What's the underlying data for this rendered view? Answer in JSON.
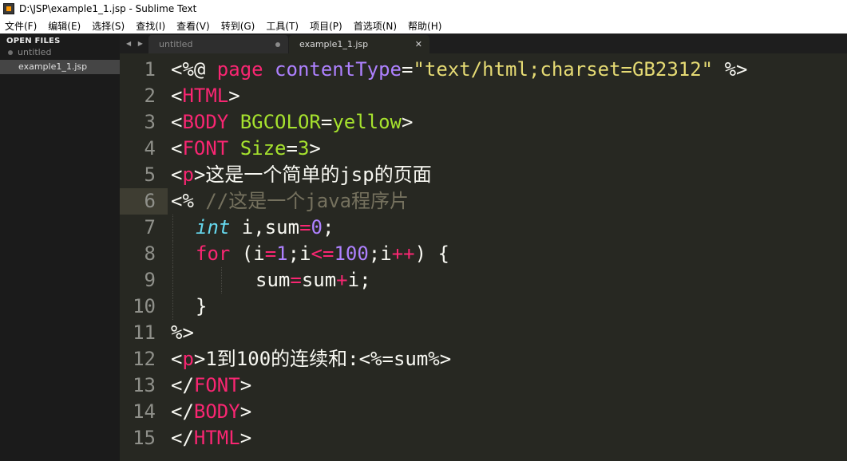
{
  "window": {
    "title": "D:\\JSP\\example1_1.jsp - Sublime Text"
  },
  "menu": [
    "文件(F)",
    "编辑(E)",
    "选择(S)",
    "查找(I)",
    "查看(V)",
    "转到(G)",
    "工具(T)",
    "项目(P)",
    "首选项(N)",
    "帮助(H)"
  ],
  "sidebar": {
    "header": "OPEN FILES",
    "files": [
      {
        "name": "untitled",
        "active": false,
        "modified": true
      },
      {
        "name": "example1_1.jsp",
        "active": true,
        "modified": false
      }
    ]
  },
  "tabs": [
    {
      "label": "untitled",
      "active": false,
      "modified": true
    },
    {
      "label": "example1_1.jsp",
      "active": true,
      "modified": false
    }
  ],
  "tab_arrows": "◀ ▶",
  "tab_close_glyph": "✕",
  "editor": {
    "current_line": 6,
    "theme_colors": {
      "background": "#272822",
      "keyword": "#f92672",
      "attribute": "#a6e22e",
      "string": "#e6db74",
      "number": "#ae81ff",
      "type": "#66d9ef",
      "comment": "#75715e"
    },
    "lines": [
      {
        "num": "1",
        "indent": 0,
        "tokens": [
          {
            "t": "<%@ ",
            "c": "white"
          },
          {
            "t": "page",
            "c": "pink"
          },
          {
            "t": " ",
            "c": "white"
          },
          {
            "t": "contentType",
            "c": "purple2"
          },
          {
            "t": "=",
            "c": "white"
          },
          {
            "t": "\"text/html;charset=GB2312\"",
            "c": "yellow"
          },
          {
            "t": " %>",
            "c": "white"
          }
        ]
      },
      {
        "num": "2",
        "indent": 0,
        "tokens": [
          {
            "t": "<",
            "c": "white"
          },
          {
            "t": "HTML",
            "c": "pink"
          },
          {
            "t": ">",
            "c": "white"
          }
        ]
      },
      {
        "num": "3",
        "indent": 0,
        "tokens": [
          {
            "t": "<",
            "c": "white"
          },
          {
            "t": "BODY",
            "c": "pink"
          },
          {
            "t": " ",
            "c": "white"
          },
          {
            "t": "BGCOLOR",
            "c": "green"
          },
          {
            "t": "=",
            "c": "white"
          },
          {
            "t": "yellow",
            "c": "green"
          },
          {
            "t": ">",
            "c": "white"
          }
        ]
      },
      {
        "num": "4",
        "indent": 0,
        "tokens": [
          {
            "t": "<",
            "c": "white"
          },
          {
            "t": "FONT",
            "c": "pink"
          },
          {
            "t": " ",
            "c": "white"
          },
          {
            "t": "Size",
            "c": "green"
          },
          {
            "t": "=",
            "c": "white"
          },
          {
            "t": "3",
            "c": "green"
          },
          {
            "t": ">",
            "c": "white"
          }
        ]
      },
      {
        "num": "5",
        "indent": 0,
        "tokens": [
          {
            "t": "<",
            "c": "white"
          },
          {
            "t": "p",
            "c": "pink"
          },
          {
            "t": ">这是一个简单的jsp的页面",
            "c": "white"
          }
        ]
      },
      {
        "num": "6",
        "indent": 0,
        "tokens": [
          {
            "t": "<% ",
            "c": "white"
          },
          {
            "t": "//这是一个java程序片",
            "c": "comment"
          }
        ]
      },
      {
        "num": "7",
        "indent": 1,
        "tokens": [
          {
            "t": "int",
            "c": "cyan-it"
          },
          {
            "t": " i,sum",
            "c": "white"
          },
          {
            "t": "=",
            "c": "pink"
          },
          {
            "t": "0",
            "c": "purple"
          },
          {
            "t": ";",
            "c": "white"
          }
        ]
      },
      {
        "num": "8",
        "indent": 1,
        "tokens": [
          {
            "t": "for",
            "c": "pink"
          },
          {
            "t": " (i",
            "c": "white"
          },
          {
            "t": "=",
            "c": "pink"
          },
          {
            "t": "1",
            "c": "purple"
          },
          {
            "t": ";i",
            "c": "white"
          },
          {
            "t": "<=",
            "c": "pink"
          },
          {
            "t": "100",
            "c": "purple"
          },
          {
            "t": ";i",
            "c": "white"
          },
          {
            "t": "++",
            "c": "pink"
          },
          {
            "t": ") {",
            "c": "white"
          }
        ]
      },
      {
        "num": "9",
        "indent": 2,
        "tokens": [
          {
            "t": "sum",
            "c": "white"
          },
          {
            "t": "=",
            "c": "pink"
          },
          {
            "t": "sum",
            "c": "white"
          },
          {
            "t": "+",
            "c": "pink"
          },
          {
            "t": "i;",
            "c": "white"
          }
        ]
      },
      {
        "num": "10",
        "indent": 1,
        "tokens": [
          {
            "t": "}",
            "c": "white"
          }
        ]
      },
      {
        "num": "11",
        "indent": 0,
        "tokens": [
          {
            "t": "%>",
            "c": "white"
          }
        ]
      },
      {
        "num": "12",
        "indent": 0,
        "tokens": [
          {
            "t": "<",
            "c": "white"
          },
          {
            "t": "p",
            "c": "pink"
          },
          {
            "t": ">1到100的连续和:<%=sum%>",
            "c": "white"
          }
        ]
      },
      {
        "num": "13",
        "indent": 0,
        "tokens": [
          {
            "t": "</",
            "c": "white"
          },
          {
            "t": "FONT",
            "c": "pink"
          },
          {
            "t": ">",
            "c": "white"
          }
        ]
      },
      {
        "num": "14",
        "indent": 0,
        "tokens": [
          {
            "t": "</",
            "c": "white"
          },
          {
            "t": "BODY",
            "c": "pink"
          },
          {
            "t": ">",
            "c": "white"
          }
        ]
      },
      {
        "num": "15",
        "indent": 0,
        "tokens": [
          {
            "t": "</",
            "c": "white"
          },
          {
            "t": "HTML",
            "c": "pink"
          },
          {
            "t": ">",
            "c": "white"
          }
        ]
      }
    ]
  }
}
